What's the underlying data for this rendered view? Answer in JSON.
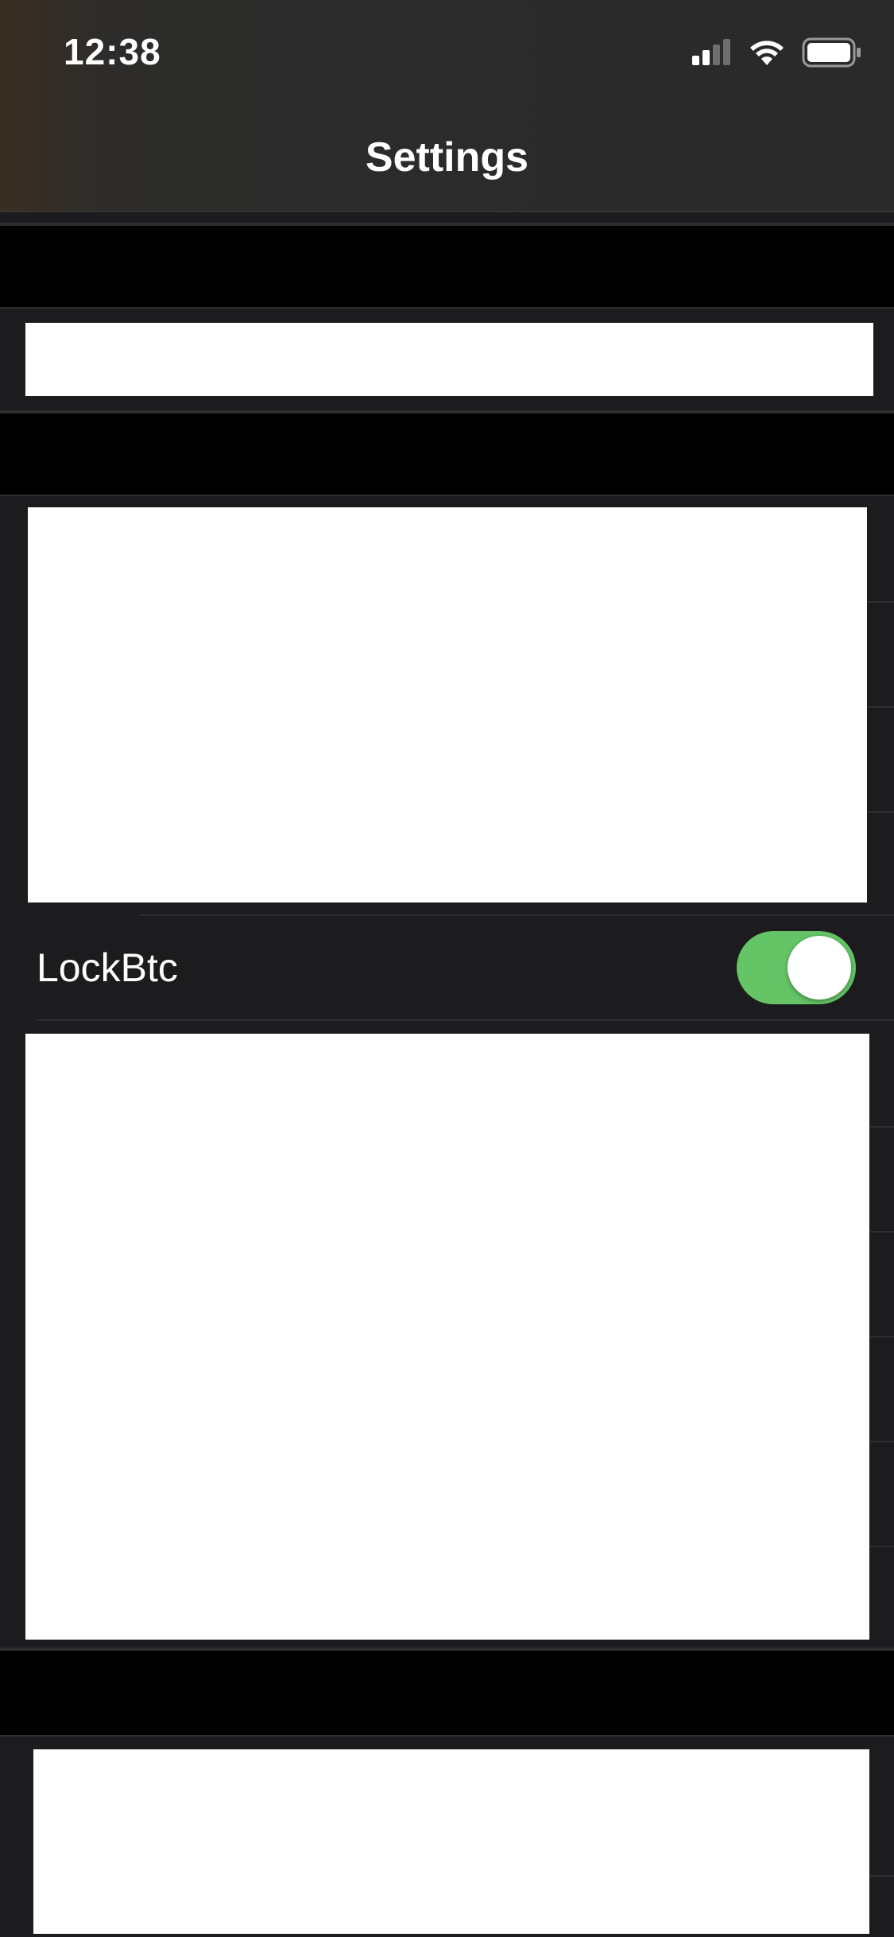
{
  "status_bar": {
    "time": "12:38",
    "signal_icon": "cellular-signal-icon",
    "wifi_icon": "wifi-icon",
    "battery_icon": "battery-icon"
  },
  "nav": {
    "title": "Settings"
  },
  "rows": {
    "lock_btc": {
      "label": "LockBtc",
      "toggle_on": true
    }
  },
  "colors": {
    "background": "#1c1c1e",
    "section_header": "#000000",
    "toggle_on": "#64c466"
  }
}
